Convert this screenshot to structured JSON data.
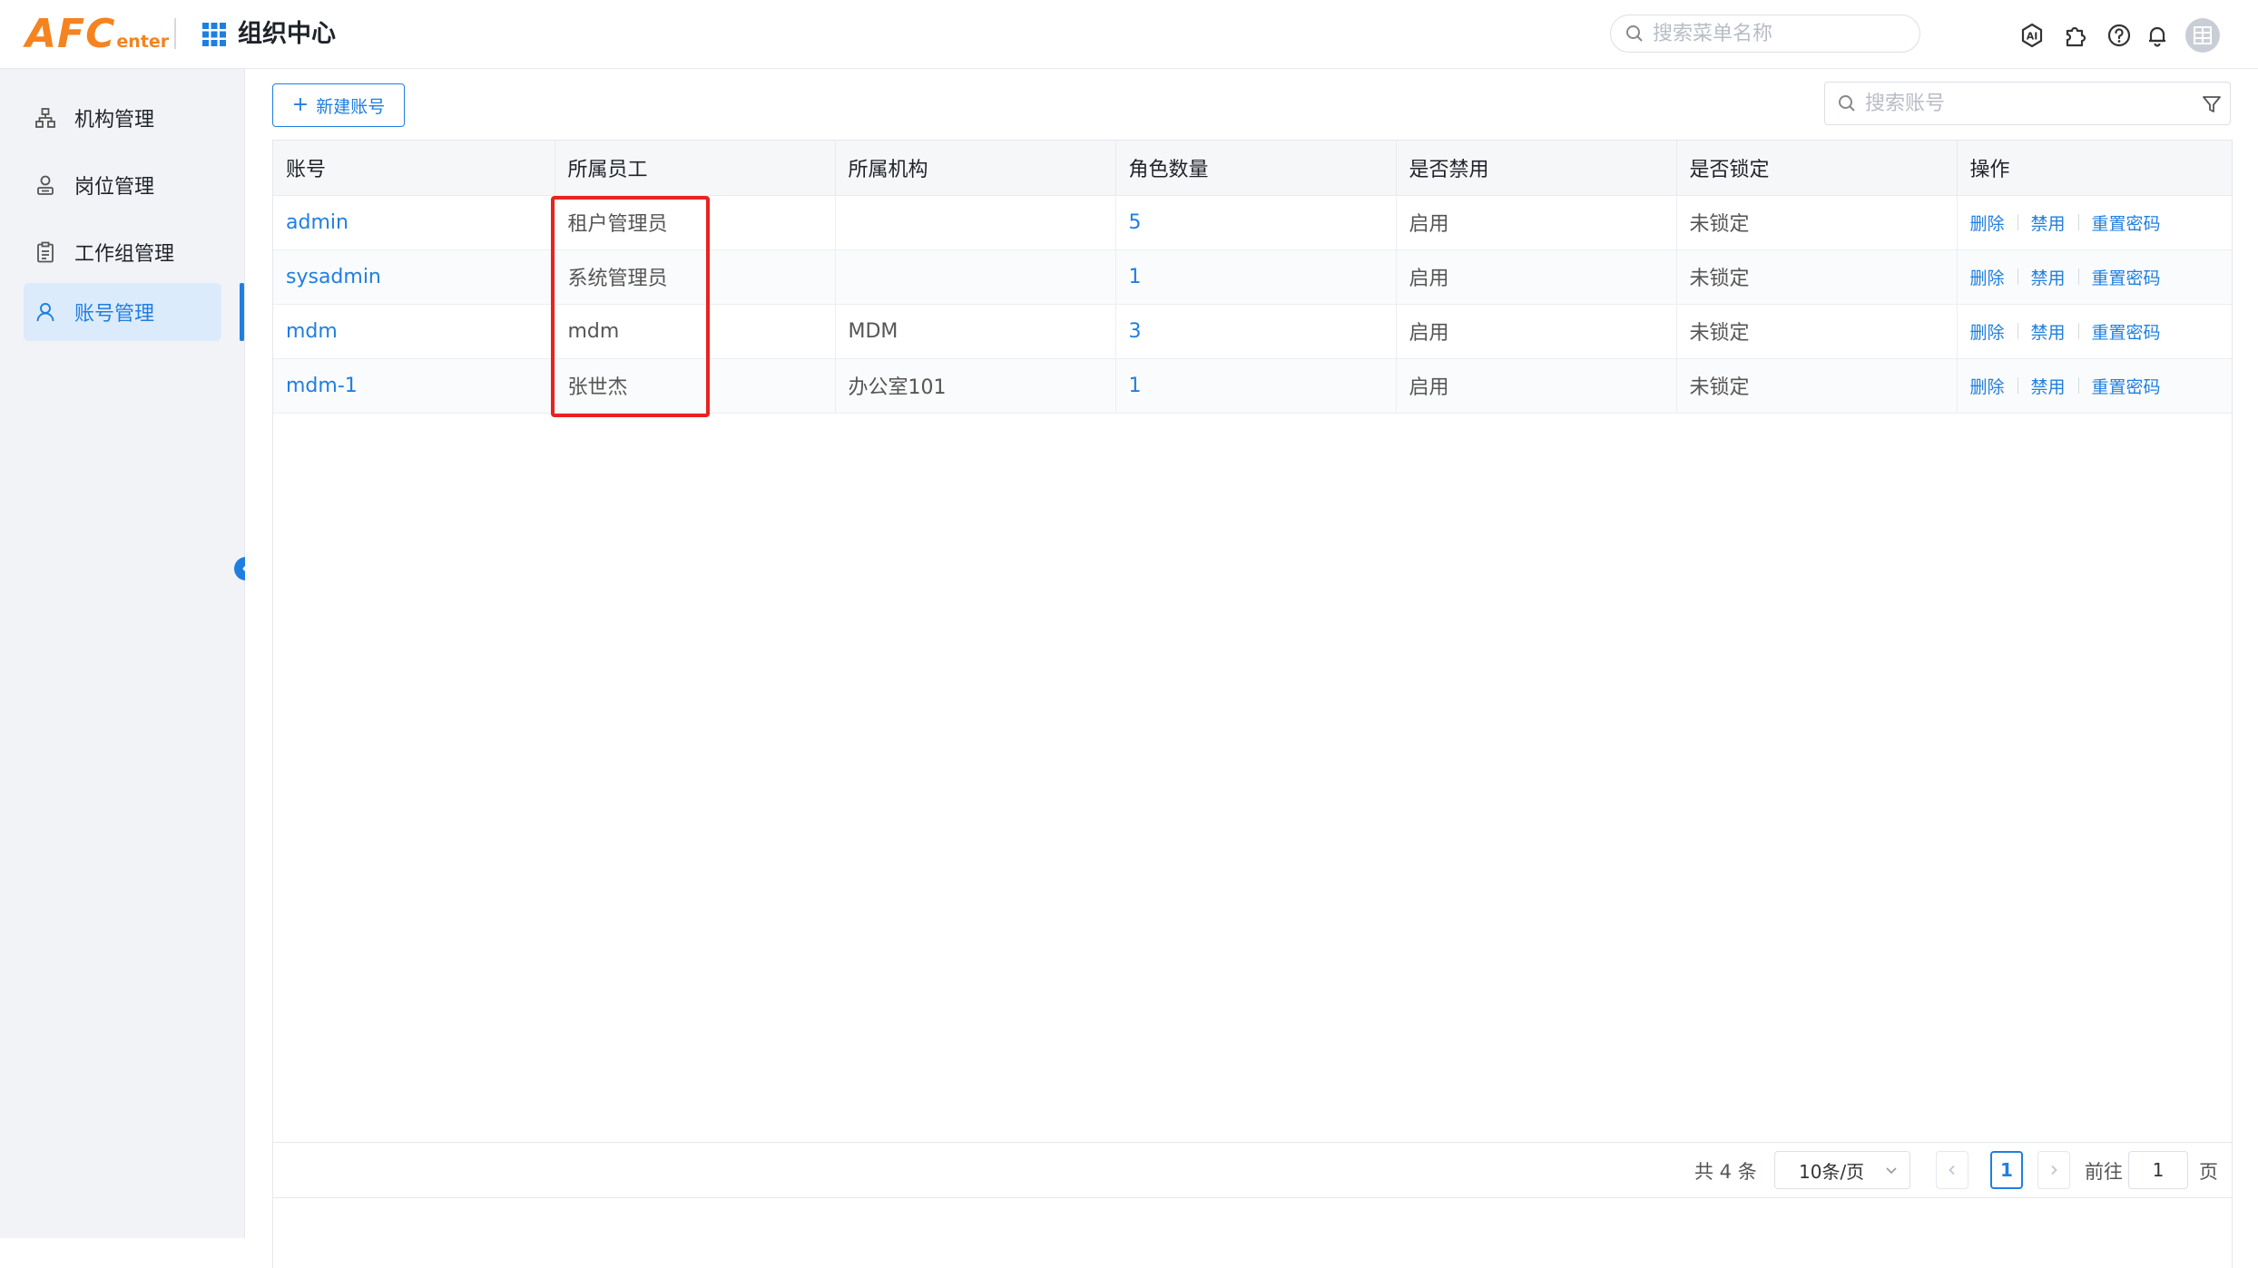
{
  "header": {
    "logo_main": "AFC",
    "logo_sub": "enter",
    "app_title": "组织中心",
    "search_placeholder": "搜索菜单名称"
  },
  "sidebar": {
    "items": [
      {
        "label": "机构管理",
        "icon": "org-tree-icon",
        "active": false
      },
      {
        "label": "岗位管理",
        "icon": "position-icon",
        "active": false
      },
      {
        "label": "工作组管理",
        "icon": "clipboard-icon",
        "active": false
      },
      {
        "label": "账号管理",
        "icon": "user-icon",
        "active": true
      }
    ]
  },
  "toolbar": {
    "new_label": "新建账号",
    "search_placeholder": "搜索账号"
  },
  "table": {
    "columns": [
      "账号",
      "所属员工",
      "所属机构",
      "角色数量",
      "是否禁用",
      "是否锁定",
      "操作"
    ],
    "rows": [
      {
        "account": "admin",
        "employee": "租户管理员",
        "org": "",
        "roles": "5",
        "disabled": "启用",
        "locked": "未锁定"
      },
      {
        "account": "sysadmin",
        "employee": "系统管理员",
        "org": "",
        "roles": "1",
        "disabled": "启用",
        "locked": "未锁定"
      },
      {
        "account": "mdm",
        "employee": "mdm",
        "org": "MDM",
        "roles": "3",
        "disabled": "启用",
        "locked": "未锁定"
      },
      {
        "account": "mdm-1",
        "employee": "张世杰",
        "org": "办公室101",
        "roles": "1",
        "disabled": "启用",
        "locked": "未锁定"
      }
    ],
    "ops": {
      "delete": "删除",
      "disable": "禁用",
      "reset": "重置密码"
    }
  },
  "pager": {
    "total": "共 4 条",
    "page_size": "10条/页",
    "current_page": "1",
    "goto_label": "前往",
    "goto_value": "1",
    "page_label": "页"
  },
  "colors": {
    "accent": "#1f7fe0",
    "logo": "#f5831f",
    "highlight": "#e8231f"
  }
}
